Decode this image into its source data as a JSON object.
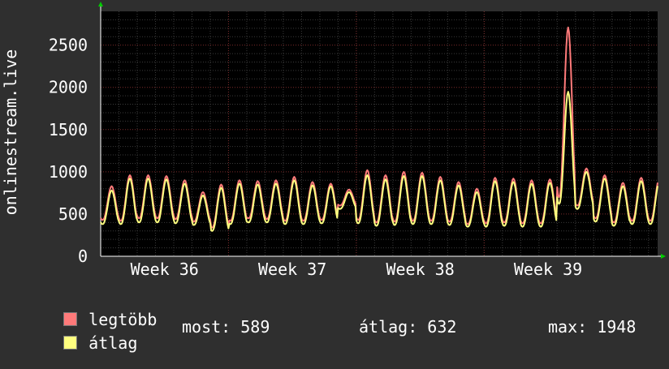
{
  "chart_data": {
    "type": "line",
    "ylabel": "onlinestream.live",
    "ylim": [
      0,
      2900
    ],
    "yticks": [
      0,
      500,
      1000,
      1500,
      2000,
      2500
    ],
    "x_range_days": [
      0,
      30.5
    ],
    "xticks": [
      {
        "label": "Week 36",
        "day": 3.5
      },
      {
        "label": "Week 37",
        "day": 10.5
      },
      {
        "label": "Week 38",
        "day": 17.5
      },
      {
        "label": "Week 39",
        "day": 24.5
      }
    ],
    "grid": true,
    "legend_position": "bottom-left",
    "series": [
      {
        "name": "legtöbb",
        "color": "#ff7a7a",
        "daily_peaks": [
          830,
          960,
          960,
          950,
          900,
          760,
          850,
          900,
          890,
          900,
          940,
          880,
          860,
          790,
          1020,
          960,
          1000,
          990,
          940,
          880,
          800,
          930,
          920,
          900,
          910,
          2710,
          1040,
          960,
          870,
          930
        ],
        "daily_troughs": [
          430,
          420,
          450,
          450,
          440,
          410,
          340,
          420,
          450,
          440,
          420,
          420,
          430,
          600,
          430,
          400,
          410,
          420,
          420,
          410,
          380,
          390,
          400,
          390,
          390,
          700,
          600,
          450,
          400,
          420
        ]
      },
      {
        "name": "átlag",
        "color": "#ffff80",
        "daily_peaks": [
          780,
          920,
          920,
          910,
          860,
          720,
          810,
          860,
          850,
          860,
          900,
          840,
          830,
          760,
          960,
          910,
          950,
          950,
          900,
          840,
          760,
          890,
          880,
          860,
          870,
          1948,
          1000,
          920,
          830,
          890
        ],
        "daily_troughs": [
          380,
          380,
          400,
          400,
          390,
          370,
          300,
          380,
          400,
          400,
          380,
          380,
          390,
          560,
          390,
          360,
          370,
          380,
          380,
          370,
          350,
          350,
          360,
          350,
          350,
          620,
          560,
          410,
          360,
          380
        ]
      }
    ]
  },
  "legend": {
    "items": [
      {
        "label": "legtöbb",
        "color": "#ff7a7a"
      },
      {
        "label": "átlag",
        "color": "#ffff80"
      }
    ],
    "stats": {
      "now": "most: 589",
      "avg": "átlag: 632",
      "max": "max: 1948"
    }
  }
}
